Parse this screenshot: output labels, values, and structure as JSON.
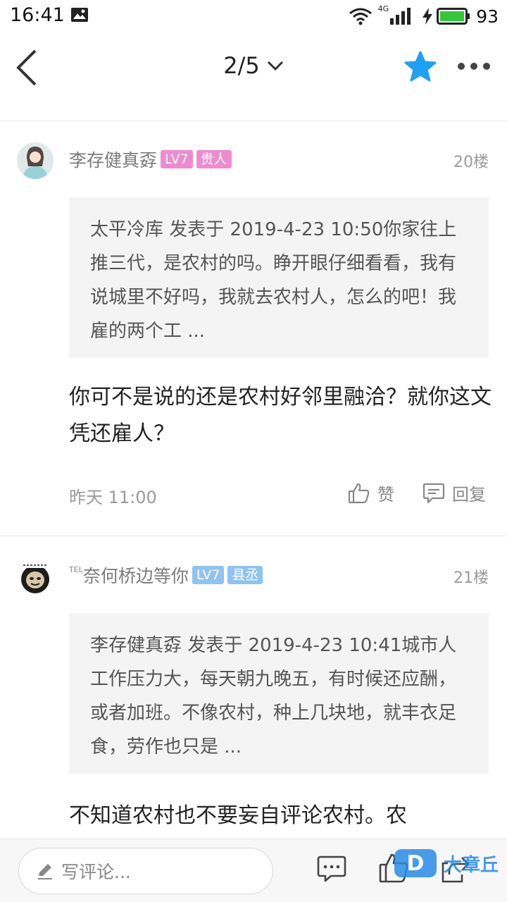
{
  "status_bar": {
    "time": "16:41",
    "network": "4G",
    "battery": "93",
    "icons": [
      "image-icon",
      "wifi-icon",
      "signal-icon",
      "charging-icon",
      "battery-icon"
    ]
  },
  "nav": {
    "page_indicator": "2/5",
    "icons": [
      "back-icon",
      "chevron-down-icon",
      "star-icon",
      "more-icon"
    ],
    "star_color": "#1ea1f2"
  },
  "posts": [
    {
      "username": "李存健真孬",
      "level": "LV7",
      "title": "贵人",
      "badge_color": "#f08ad0",
      "floor": "20楼",
      "quote": "太平冷库 发表于 2019-4-23 10:50你家往上推三代，是农村的吗。睁开眼仔细看看，我有说城里不好吗，我就去农村人，怎么的吧！我雇的两个工 ...",
      "content": "你可不是说的还是农村好邻里融洽？就你这文凭还雇人？",
      "time": "昨天 11:00",
      "like_label": "赞",
      "reply_label": "回复"
    },
    {
      "username_prefix": "TEL",
      "username": "奈何桥边等你",
      "level": "LV7",
      "title": "县丞",
      "badge_color": "#8fc3f3",
      "floor": "21楼",
      "quote": "李存健真孬 发表于 2019-4-23 10:41城市人工作压力大，每天朝九晚五，有时候还应酬，或者加班。不像农村，种上几块地，就丰衣足食，劳作也只是 ...",
      "content": "不知道农村也不要妄自评论农村。农"
    }
  ],
  "bottom_bar": {
    "comment_placeholder": "写评论...",
    "icons": [
      "edit-icon",
      "comment-icon",
      "like-icon",
      "share-icon"
    ],
    "watermark_logo": "D",
    "watermark_text": "大章丘"
  }
}
